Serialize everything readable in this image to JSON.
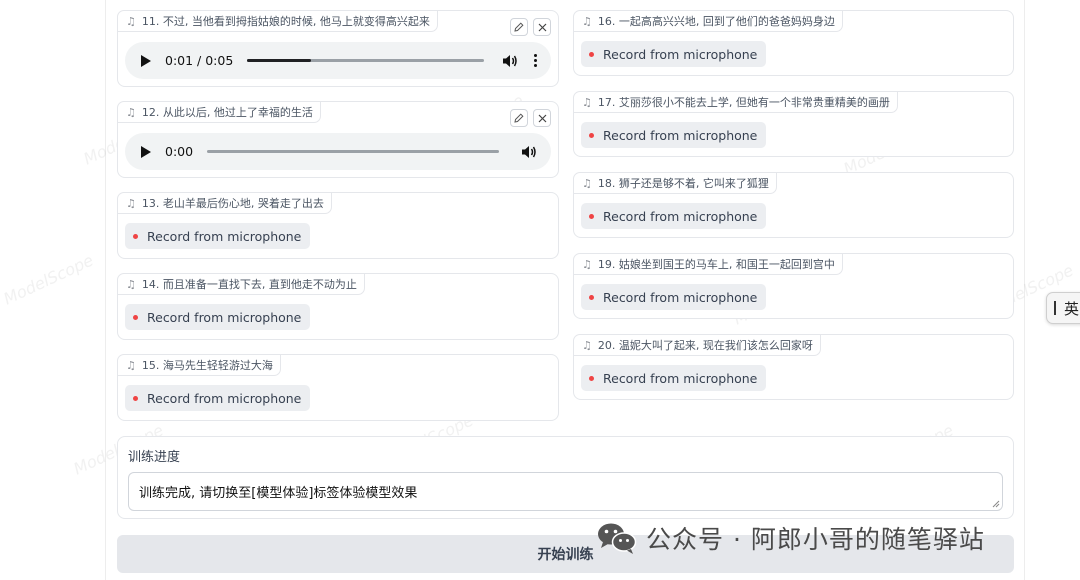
{
  "watermark_text": "ModelScope",
  "left_items": [
    {
      "label": "11. 不过, 当他看到拇指姑娘的时候, 他马上就变得高兴起来",
      "type": "audio",
      "time": "0:01 / 0:05",
      "progress": 0.27
    },
    {
      "label": "12. 从此以后, 他过上了幸福的生活",
      "type": "audio",
      "time": "0:00",
      "progress": 0
    },
    {
      "label": "13. 老山羊最后伤心地, 哭着走了出去",
      "type": "record"
    },
    {
      "label": "14. 而且准备一直找下去, 直到他走不动为止",
      "type": "record"
    },
    {
      "label": "15. 海马先生轻轻游过大海",
      "type": "record"
    }
  ],
  "right_items": [
    {
      "label": "16. 一起高高兴兴地, 回到了他们的爸爸妈妈身边",
      "type": "record"
    },
    {
      "label": "17. 艾丽莎很小不能去上学, 但她有一个非常贵重精美的画册",
      "type": "record"
    },
    {
      "label": "18. 狮子还是够不着, 它叫来了狐狸",
      "type": "record"
    },
    {
      "label": "19. 姑娘坐到国王的马车上, 和国王一起回到宫中",
      "type": "record"
    },
    {
      "label": "20. 温妮大叫了起来, 现在我们该怎么回家呀",
      "type": "record"
    }
  ],
  "record_label": "Record from microphone",
  "progress": {
    "label": "训练进度",
    "value": "训练完成, 请切换至[模型体验]标签体验模型效果"
  },
  "start_button": "开始训练",
  "ime": {
    "text": "英"
  },
  "footer_watermark": "公众号 · 阿郎小哥的随笔驿站"
}
